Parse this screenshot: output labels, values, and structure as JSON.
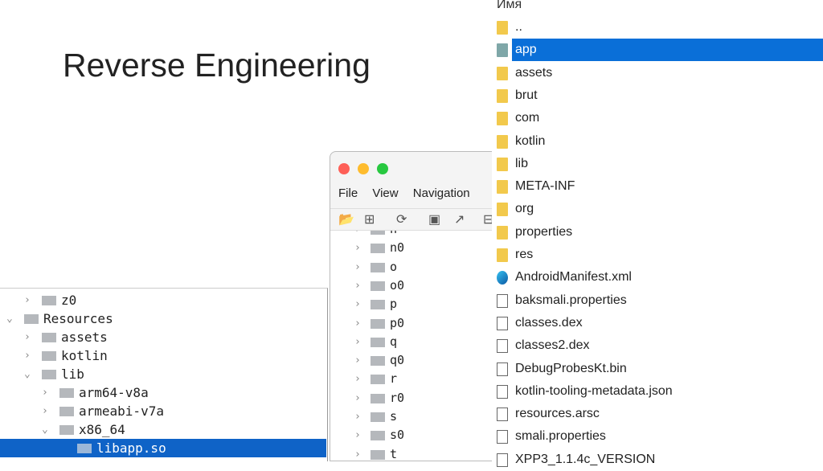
{
  "slide": {
    "title": "Reverse Engineering"
  },
  "left_tree": {
    "items": [
      {
        "label": "z0",
        "expanded": false,
        "depth": 1
      },
      {
        "label": "Resources",
        "expanded": true,
        "depth": 0
      },
      {
        "label": "assets",
        "expanded": false,
        "depth": 1
      },
      {
        "label": "kotlin",
        "expanded": false,
        "depth": 1
      },
      {
        "label": "lib",
        "expanded": true,
        "depth": 1
      },
      {
        "label": "arm64-v8a",
        "expanded": false,
        "depth": 2
      },
      {
        "label": "armeabi-v7a",
        "expanded": false,
        "depth": 2
      },
      {
        "label": "x86_64",
        "expanded": true,
        "depth": 2
      },
      {
        "label": "libapp.so",
        "selected": true,
        "depth": 3
      }
    ]
  },
  "mid_window": {
    "menu": [
      "File",
      "View",
      "Navigation"
    ],
    "tree": [
      "n",
      "n0",
      "o",
      "o0",
      "p",
      "p0",
      "q",
      "q0",
      "r",
      "r0",
      "s",
      "s0",
      "t"
    ]
  },
  "right_panel": {
    "header": "Имя",
    "items": [
      {
        "label": "..",
        "type": "folder"
      },
      {
        "label": "app",
        "type": "folder-dark",
        "selected": true
      },
      {
        "label": "assets",
        "type": "folder"
      },
      {
        "label": "brut",
        "type": "folder"
      },
      {
        "label": "com",
        "type": "folder"
      },
      {
        "label": "kotlin",
        "type": "folder"
      },
      {
        "label": "lib",
        "type": "folder"
      },
      {
        "label": "META-INF",
        "type": "folder"
      },
      {
        "label": "org",
        "type": "folder"
      },
      {
        "label": "properties",
        "type": "folder"
      },
      {
        "label": "res",
        "type": "folder"
      },
      {
        "label": "AndroidManifest.xml",
        "type": "edge"
      },
      {
        "label": "baksmali.properties",
        "type": "doc"
      },
      {
        "label": "classes.dex",
        "type": "doc"
      },
      {
        "label": "classes2.dex",
        "type": "doc"
      },
      {
        "label": "DebugProbesKt.bin",
        "type": "doc"
      },
      {
        "label": "kotlin-tooling-metadata.json",
        "type": "json"
      },
      {
        "label": "resources.arsc",
        "type": "doc"
      },
      {
        "label": "smali.properties",
        "type": "doc"
      },
      {
        "label": "XPP3_1.1.4c_VERSION",
        "type": "doc"
      }
    ]
  },
  "colors": {
    "selection": "#0a6fd8",
    "folder": "#f2c94c"
  }
}
